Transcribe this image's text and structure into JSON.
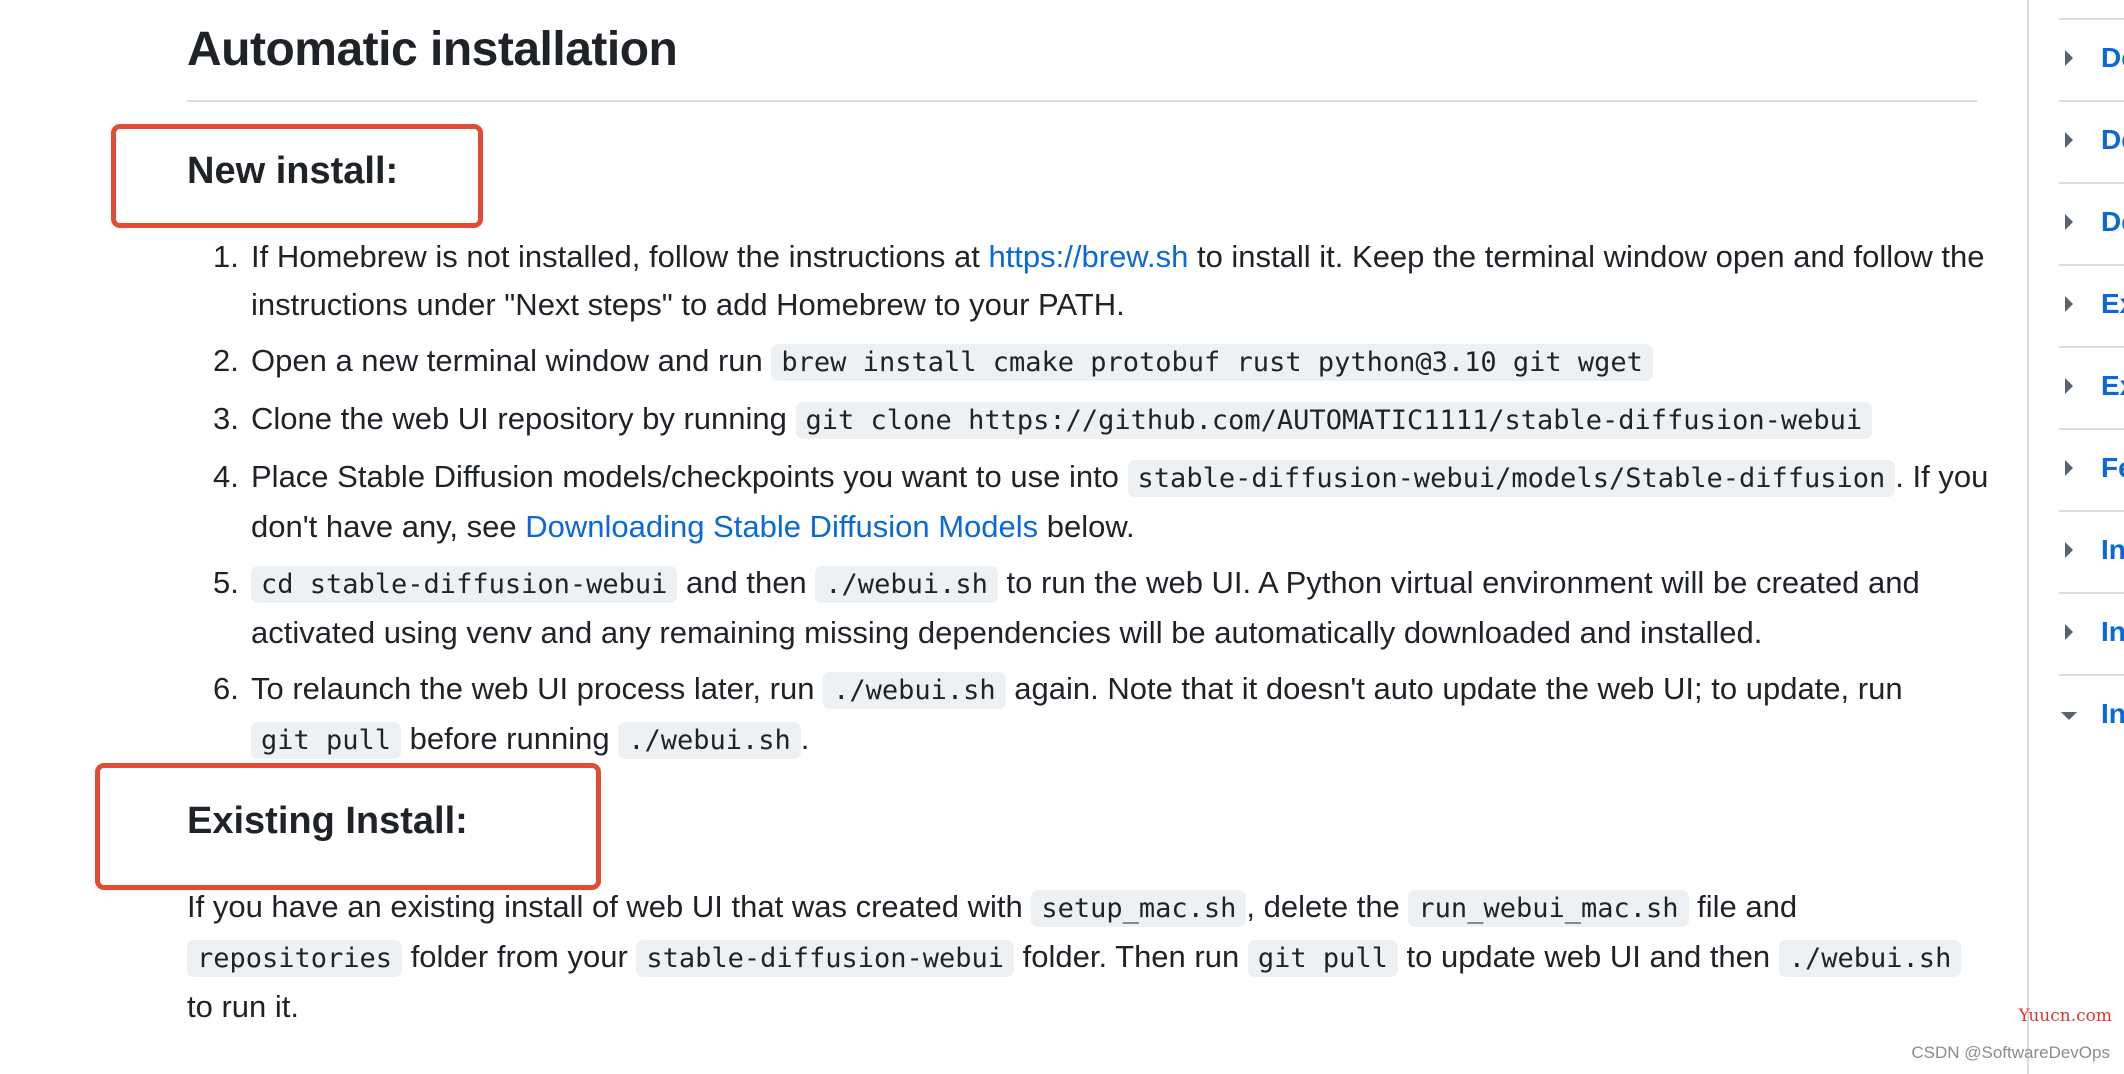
{
  "main": {
    "title": "Automatic installation",
    "new_install": {
      "heading": "New install:",
      "steps": [
        {
          "num": "1.",
          "t1": "If Homebrew is not installed, follow the instructions at ",
          "link": "https://brew.sh",
          "t2": " to install it. Keep the terminal window open and follow the instructions under \"Next steps\" to add Homebrew to your PATH."
        },
        {
          "num": "2.",
          "t1": "Open a new terminal window and run ",
          "code": "brew install cmake protobuf rust python@3.10 git wget"
        },
        {
          "num": "3.",
          "t1": "Clone the web UI repository by running ",
          "code": "git clone https://github.com/AUTOMATIC1111/stable-diffusion-webui"
        },
        {
          "num": "4.",
          "t1": "Place Stable Diffusion models/checkpoints you want to use into ",
          "code": "stable-diffusion-webui/models/Stable-diffusion",
          "t2": ". If you don't have any, see ",
          "link": "Downloading Stable Diffusion Models",
          "t3": " below."
        },
        {
          "num": "5.",
          "code1": "cd stable-diffusion-webui",
          "t1": " and then ",
          "code2": "./webui.sh",
          "t2": " to run the web UI. A Python virtual environment will be created and activated using venv and any remaining missing dependencies will be automatically downloaded and installed."
        },
        {
          "num": "6.",
          "t1": "To relaunch the web UI process later, run ",
          "code1": "./webui.sh",
          "t2": " again. Note that it doesn't auto update the web UI; to update, run ",
          "code2": "git pull",
          "t3": " before running ",
          "code3": "./webui.sh",
          "t4": "."
        }
      ]
    },
    "existing_install": {
      "heading": "Existing Install:",
      "t1": "If you have an existing install of web UI that was created with ",
      "code1": "setup_mac.sh",
      "t2": ", delete the ",
      "code2": "run_webui_mac.sh",
      "t3": " file and ",
      "code3": "repositories",
      "t4": " folder from your ",
      "code4": "stable-diffusion-webui",
      "t5": " folder. Then run ",
      "code5": "git pull",
      "t6": " to update web UI and then ",
      "code6": "./webui.sh",
      "t7": " to run it."
    }
  },
  "sidebar": {
    "items": [
      {
        "label": "De",
        "expanded": false
      },
      {
        "label": "De",
        "expanded": false
      },
      {
        "label": "De",
        "expanded": false
      },
      {
        "label": "Ex",
        "expanded": false
      },
      {
        "label": "Ex",
        "expanded": false
      },
      {
        "label": "Fe",
        "expanded": false
      },
      {
        "label": "In",
        "expanded": false
      },
      {
        "label": "In",
        "expanded": false
      },
      {
        "label": "In",
        "expanded": true
      }
    ]
  },
  "watermarks": {
    "site": "Yuucn.com",
    "author": "CSDN @SoftwareDevOps"
  },
  "colors": {
    "highlight_box": "#e24b34",
    "link": "#0969da",
    "code_bg": "#eef1f4"
  }
}
